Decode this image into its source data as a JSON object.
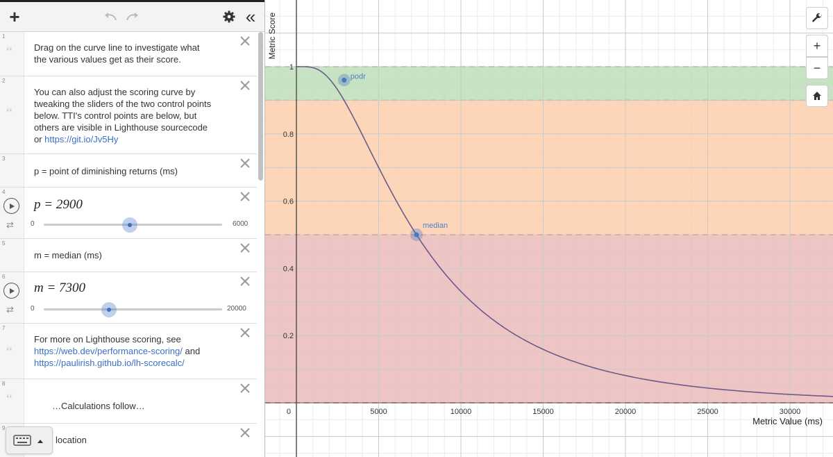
{
  "toolbar": {
    "add_label": "+",
    "collapse_label": "«"
  },
  "expressions": [
    {
      "num": "1",
      "type": "note",
      "text_lines": [
        "Drag on the curve line to investigate what",
        "the various values get as their score."
      ]
    },
    {
      "num": "2",
      "type": "note",
      "text_lines": [
        "You can also adjust the scoring curve by",
        "tweaking the sliders of the two control points",
        "below.  TTI's control points are below, but",
        "others are visible in Lighthouse sourcecode"
      ],
      "link_prefix": "or ",
      "link": "https://git.io/Jv5Hy"
    },
    {
      "num": "3",
      "type": "note",
      "text_lines": [
        "p = point of diminishing returns (ms)"
      ]
    },
    {
      "num": "4",
      "type": "slider",
      "expr": "p = 2900",
      "value": 2900,
      "min": "0",
      "max": "6000"
    },
    {
      "num": "5",
      "type": "note",
      "text_lines": [
        "m = median (ms)"
      ]
    },
    {
      "num": "6",
      "type": "slider",
      "expr": "m = 7300",
      "value": 7300,
      "min": "0",
      "max": "20000"
    },
    {
      "num": "7",
      "type": "note",
      "text_lines": [
        "For more on Lighthouse scoring, see"
      ],
      "links": [
        "https://web.dev/performance-scoring/",
        "https://paulirish.github.io/lh-scorecalc/"
      ],
      "link_join": " and"
    },
    {
      "num": "8",
      "type": "note",
      "text_lines": [
        "…Calculations follow…"
      ]
    },
    {
      "num": "9",
      "type": "note",
      "text_lines": [
        "location"
      ]
    }
  ],
  "graph_buttons": {
    "zoom_in": "+",
    "zoom_out": "−"
  },
  "colors": {
    "good_zone": "#b9dbb3",
    "average_zone": "#fccba5",
    "poor_zone": "#e9b5b5",
    "curve": "#6b5a8a",
    "point": "#4a78c2"
  },
  "chart_data": {
    "type": "line",
    "xlabel": "Metric Value (ms)",
    "ylabel": "Metric Score",
    "x_ticks": [
      0,
      5000,
      10000,
      15000,
      20000,
      25000,
      30000
    ],
    "y_ticks": [
      0.2,
      0.4,
      0.6,
      0.8,
      1
    ],
    "xlim": [
      -1800,
      33000
    ],
    "ylim": [
      -0.12,
      1.2
    ],
    "zones": [
      {
        "name": "good",
        "from": 0.9,
        "to": 1
      },
      {
        "name": "average",
        "from": 0.5,
        "to": 0.9
      },
      {
        "name": "poor",
        "from": 0,
        "to": 0.5
      }
    ],
    "points": [
      {
        "label": "podr",
        "x": 2900,
        "y": 0.96
      },
      {
        "label": "median",
        "x": 7300,
        "y": 0.5
      }
    ],
    "curve": {
      "p": 2900,
      "m": 7300
    }
  }
}
